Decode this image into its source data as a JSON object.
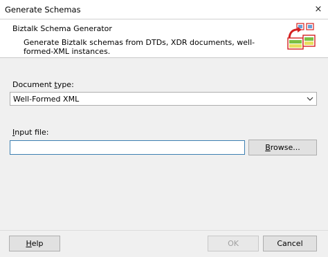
{
  "window": {
    "title": "Generate Schemas",
    "close_glyph": "×"
  },
  "header": {
    "title": "Biztalk Schema Generator",
    "description": "Generate Biztalk schemas from DTDs, XDR documents, well-formed-XML instances.",
    "icon": "schema-generator-icon"
  },
  "document_type": {
    "label_pre": "Document ",
    "label_key": "t",
    "label_post": "ype:",
    "selected": "Well-Formed XML"
  },
  "input_file": {
    "label_pre": "",
    "label_key": "I",
    "label_post": "nput file:",
    "value": "",
    "browse_pre": "",
    "browse_key": "B",
    "browse_post": "rowse..."
  },
  "footer": {
    "help_pre": "",
    "help_key": "H",
    "help_post": "elp",
    "ok_label": "OK",
    "cancel_label": "Cancel"
  },
  "colors": {
    "focus_border": "#3c7fb1",
    "icon_red": "#d42020",
    "icon_green": "#7bc043"
  }
}
